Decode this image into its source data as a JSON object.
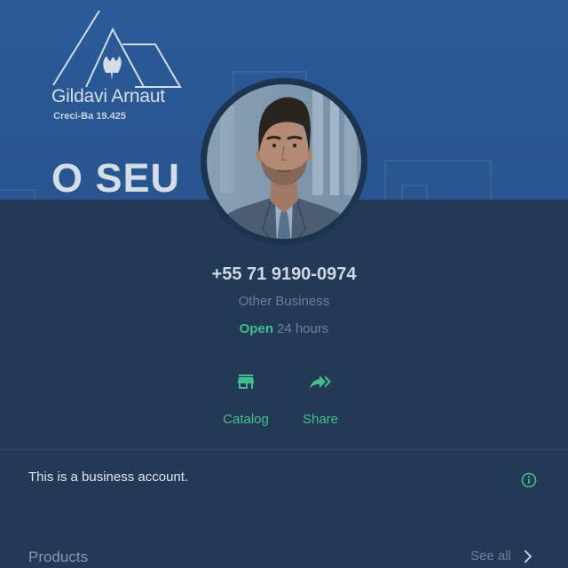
{
  "cover": {
    "brand_name": "Gildavi Arnaut",
    "brand_license": "Creci-Ba 19.425",
    "headline": "O SEU",
    "background_color": "#2a5795"
  },
  "profile": {
    "phone": "+55 71 9190-0974",
    "category": "Other Business",
    "hours": {
      "status": "Open",
      "detail": "24 hours"
    }
  },
  "actions": [
    {
      "label": "Catalog",
      "icon": "store-icon"
    },
    {
      "label": "Share",
      "icon": "share-forward-icon"
    }
  ],
  "business_note": {
    "text": "This is a business account.",
    "icon": "info-icon"
  },
  "products": {
    "title": "Products",
    "see_all_label": "See all",
    "icon": "chevron-right-icon"
  },
  "colors": {
    "accent": "#42bf8d",
    "panel": "#233a56",
    "text_primary": "#d3dbe5",
    "text_muted": "#6b8198"
  }
}
